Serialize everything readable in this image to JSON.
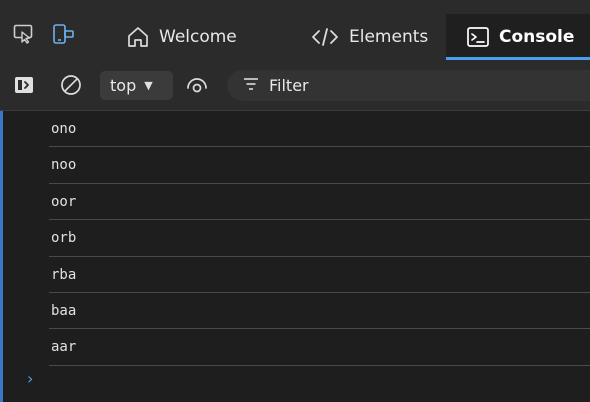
{
  "tabs": [
    {
      "label": "Welcome",
      "icon": "home-icon",
      "active": false
    },
    {
      "label": "Elements",
      "icon": "code-icon",
      "active": false
    },
    {
      "label": "Console",
      "icon": "console-icon",
      "active": true
    }
  ],
  "toolbar": {
    "context": "top",
    "filter_placeholder": "Filter"
  },
  "console": {
    "messages": [
      "ono",
      "noo",
      "oor",
      "orb",
      "rba",
      "baa",
      "aar"
    ],
    "prompt": "›"
  },
  "colors": {
    "accent": "#4a9eed",
    "background": "#1e1e1e",
    "toolbar": "#2b2b2b",
    "text": "#e0e0e0"
  }
}
